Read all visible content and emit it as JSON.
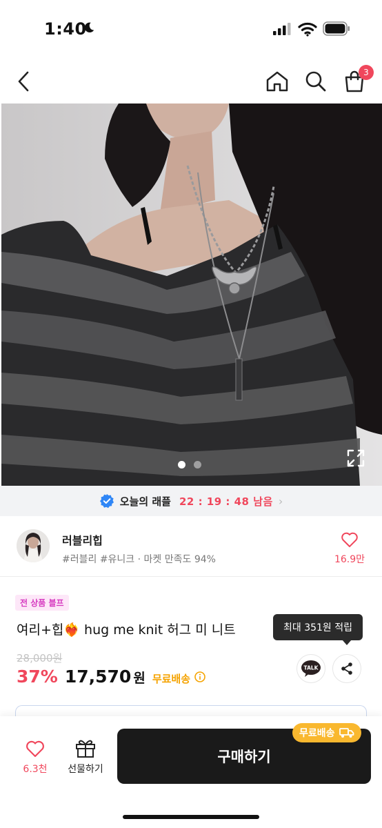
{
  "status_bar": {
    "time": "1:40",
    "moon_icon": "moon-icon",
    "signal_icon": "cellular-signal-icon",
    "wifi_icon": "wifi-icon",
    "battery_icon": "battery-icon"
  },
  "nav": {
    "back_icon": "chevron-left-icon",
    "home_icon": "home-icon",
    "search_icon": "search-icon",
    "cart_icon": "shopping-bag-icon",
    "cart_count": "3"
  },
  "gallery": {
    "page_count": 2,
    "active_page": 1,
    "expand_icon": "expand-icon"
  },
  "raffle": {
    "label": "오늘의 래플",
    "timer": "22 : 19 : 48 남음",
    "verified_icon": "verified-badge-icon"
  },
  "shop": {
    "name": "러블리힙",
    "meta": "#러블리 #유니크 · 마켓 만족도 94%",
    "like_count": "16.9만"
  },
  "product": {
    "tag": "전 상품 블프",
    "title": "여리+힙❤️‍🔥 hug me knit 허그 미 니트",
    "original_price": "28,000원",
    "discount": "37%",
    "price": "17,570",
    "won": "원",
    "free_shipping": "무료배송",
    "tooltip": "최대 351원 적립",
    "talk_label": "TALK"
  },
  "bottom_bar": {
    "like_count": "6.3천",
    "gift_label": "선물하기",
    "buy_label": "구매하기",
    "ship_badge": "무료배송"
  },
  "colors": {
    "accent": "#f0475c",
    "shipping": "#f5a300",
    "tag_bg": "#fde7f8",
    "tag_fg": "#d63cc0",
    "buy_button": "#1a1a1a"
  }
}
